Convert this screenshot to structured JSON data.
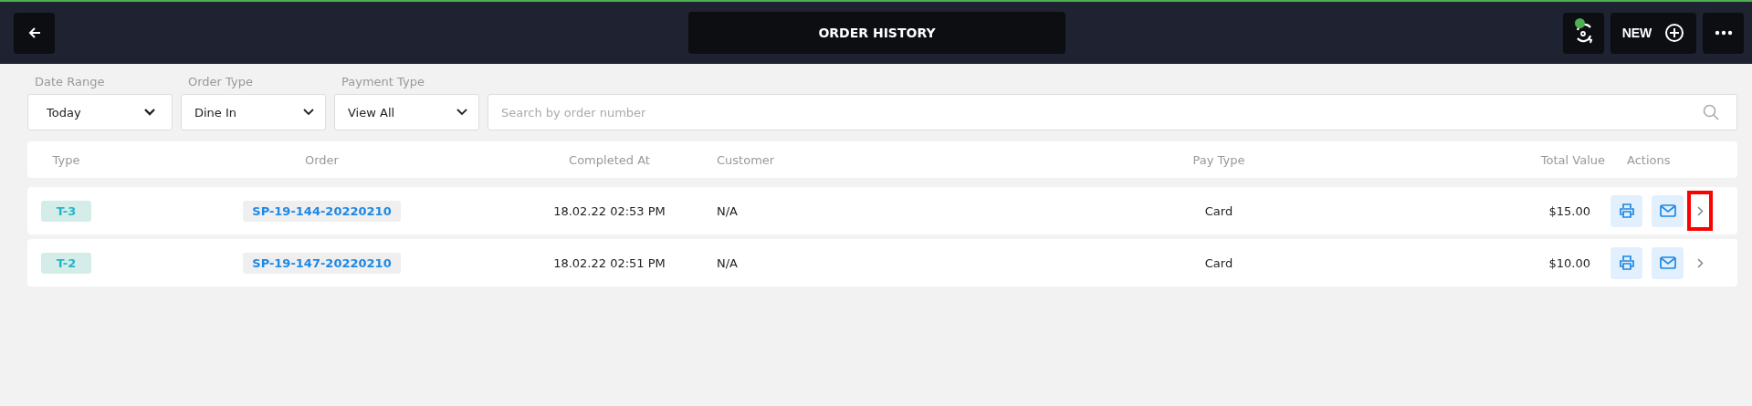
{
  "header": {
    "title": "ORDER HISTORY",
    "new_button": "NEW",
    "sync_online": true
  },
  "filters": [
    {
      "label": "Date Range",
      "value": "Today"
    },
    {
      "label": "Order Type",
      "value": "Dine In"
    },
    {
      "label": "Payment Type",
      "value": "View All"
    }
  ],
  "search": {
    "placeholder": "Search by order number"
  },
  "table": {
    "columns": [
      "Type",
      "Order",
      "Completed At",
      "Customer",
      "Pay Type",
      "Total Value",
      "Actions"
    ],
    "rows": [
      {
        "type": "T-3",
        "order": "SP-19-144-20220210",
        "completed_at": "18.02.22 02:53 PM",
        "customer": "N/A",
        "pay_type": "Card",
        "total": "$15.00",
        "highlighted": true
      },
      {
        "type": "T-2",
        "order": "SP-19-147-20220210",
        "completed_at": "18.02.22 02:51 PM",
        "customer": "N/A",
        "pay_type": "Card",
        "total": "$10.00",
        "highlighted": false
      }
    ]
  }
}
